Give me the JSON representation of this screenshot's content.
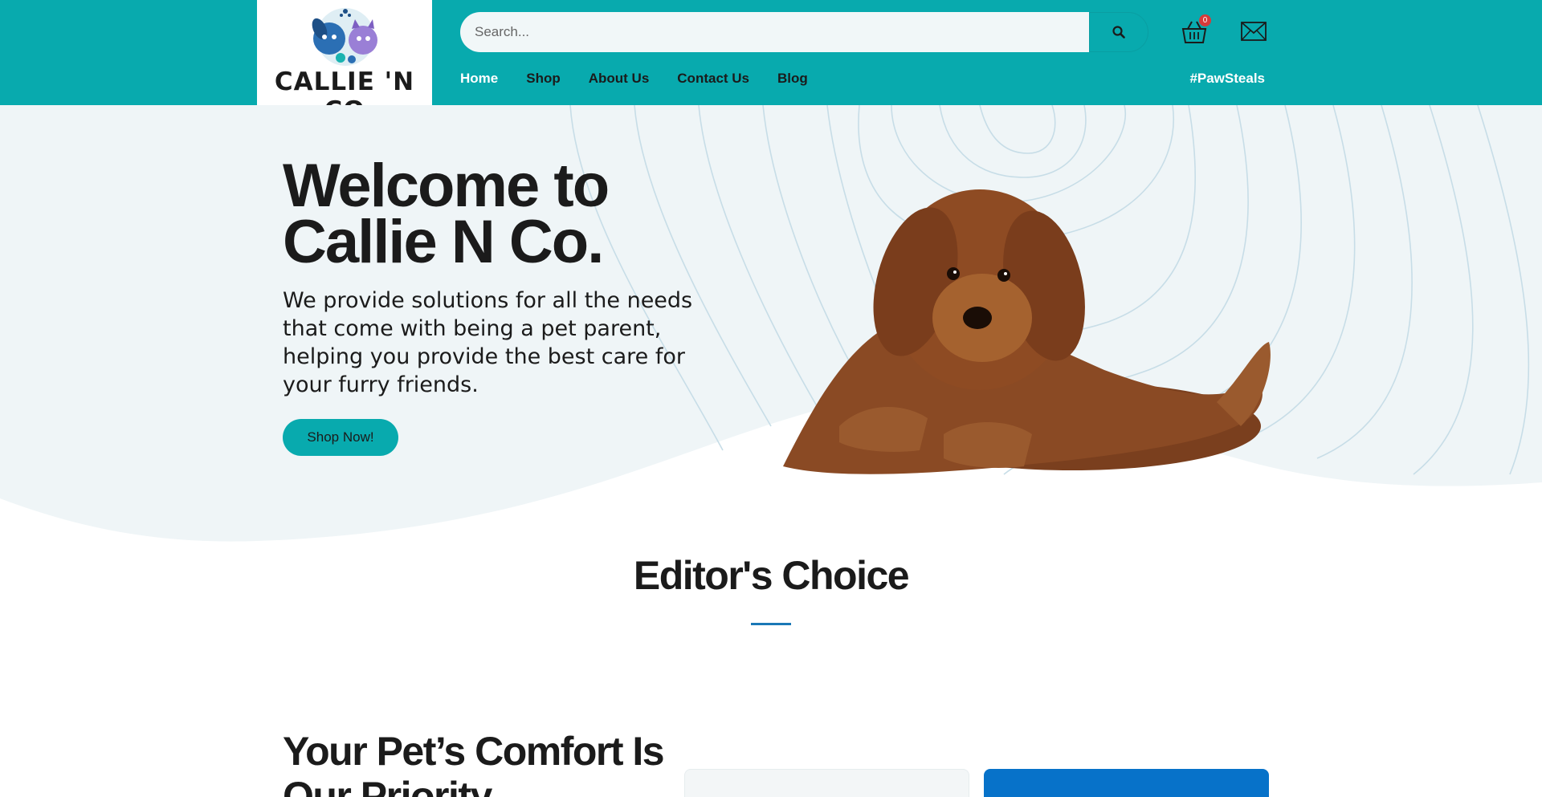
{
  "header": {
    "logo_text": "CALLIE 'N CO",
    "search": {
      "placeholder": "Search..."
    },
    "cart_count": "0",
    "nav": [
      {
        "label": "Home",
        "active": true
      },
      {
        "label": "Shop",
        "active": false
      },
      {
        "label": "About Us",
        "active": false
      },
      {
        "label": "Contact Us",
        "active": false
      },
      {
        "label": "Blog",
        "active": false
      }
    ],
    "promo_link": "#PawSteals"
  },
  "hero": {
    "title_line1": "Welcome to",
    "title_line2": "Callie N Co.",
    "subtitle": "We provide solutions for all the needs that come with being a pet parent, helping you provide the best care for your furry friends.",
    "cta_label": "Shop Now!"
  },
  "editors_choice": {
    "title": "Editor's Choice"
  },
  "comfort": {
    "title": "Your Pet’s Comfort Is Our Priority"
  },
  "colors": {
    "brand_teal": "#08aaae",
    "hero_bg": "#eff5f7",
    "accent_blue": "#0772c9",
    "text_dark": "#1b1b1b"
  },
  "icons": [
    "search-icon",
    "cart-icon",
    "mail-icon",
    "logo-mascot-icon"
  ]
}
